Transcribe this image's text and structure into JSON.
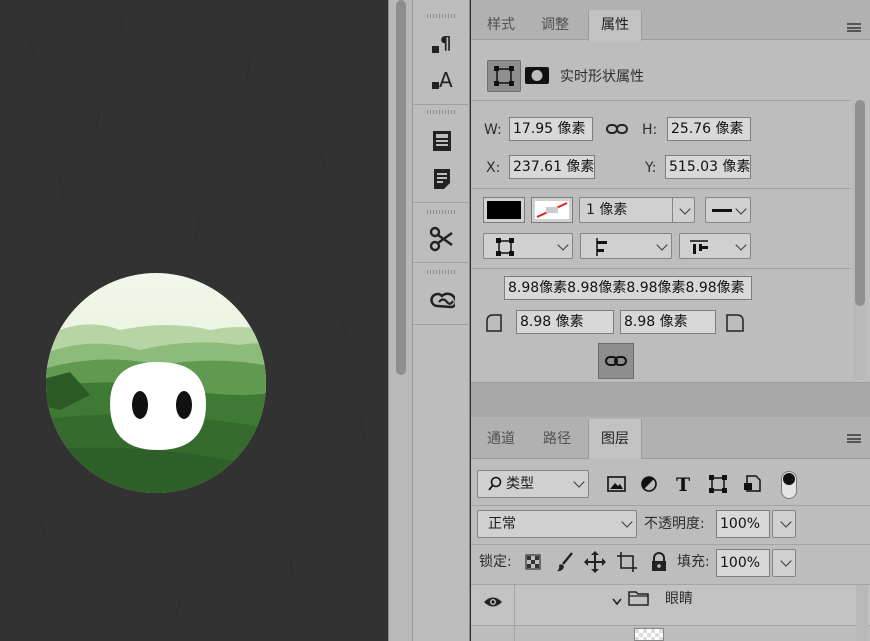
{
  "properties_panel": {
    "tabs": [
      {
        "label": "样式"
      },
      {
        "label": "调整"
      },
      {
        "label": "属性"
      }
    ],
    "section_title": "实时形状属性",
    "w_label": "W:",
    "w_value": "17.95 像素",
    "h_label": "H:",
    "h_value": "25.76 像素",
    "x_label": "X:",
    "x_value": "237.61 像素",
    "y_label": "Y:",
    "y_value": "515.03 像素",
    "stroke_width": "1 像素",
    "corner_radii_combined": "8.98像素8.98像素8.98像素8.98像素",
    "corner_left": "8.98 像素",
    "corner_right": "8.98 像素"
  },
  "layers_panel": {
    "tabs": [
      {
        "label": "通道"
      },
      {
        "label": "路径"
      },
      {
        "label": "图层"
      }
    ],
    "filter_label": "类型",
    "blend_mode": "正常",
    "opacity_label": "不透明度:",
    "opacity_value": "100%",
    "lock_label": "锁定:",
    "fill_label": "填充:",
    "fill_value": "100%",
    "group_name": "眼睛"
  },
  "colors": {
    "canvas_bg": "#323232",
    "panel_bg": "#bdbdbd",
    "accent_tab": "#c2c2c2"
  }
}
